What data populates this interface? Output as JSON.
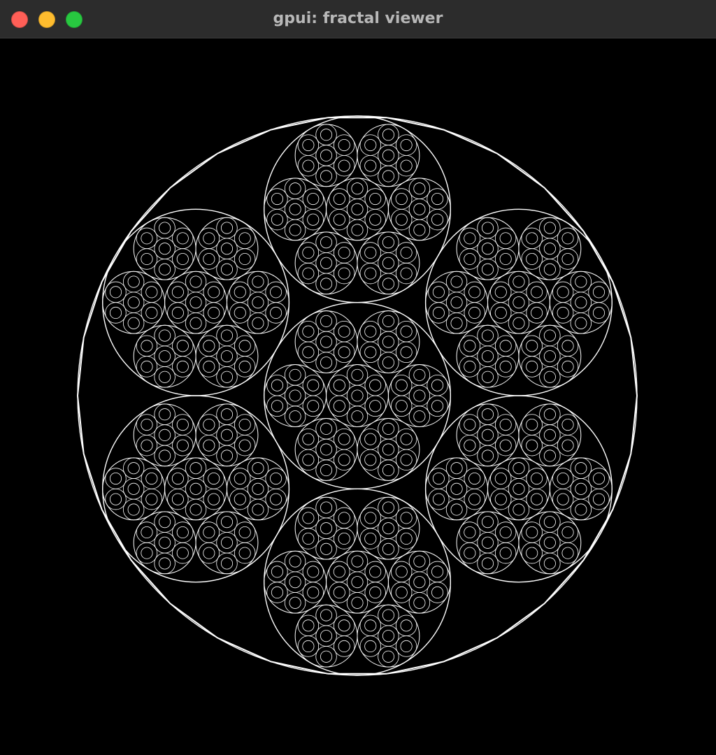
{
  "window": {
    "title": "gpui: fractal viewer",
    "controls": [
      {
        "name": "close",
        "color": "#ff5f57"
      },
      {
        "name": "minimize",
        "color": "#febc2e"
      },
      {
        "name": "maximize",
        "color": "#28c840"
      }
    ]
  },
  "canvas": {
    "background": "#000000",
    "stroke": "#ffffff",
    "petal_count": 6
  }
}
